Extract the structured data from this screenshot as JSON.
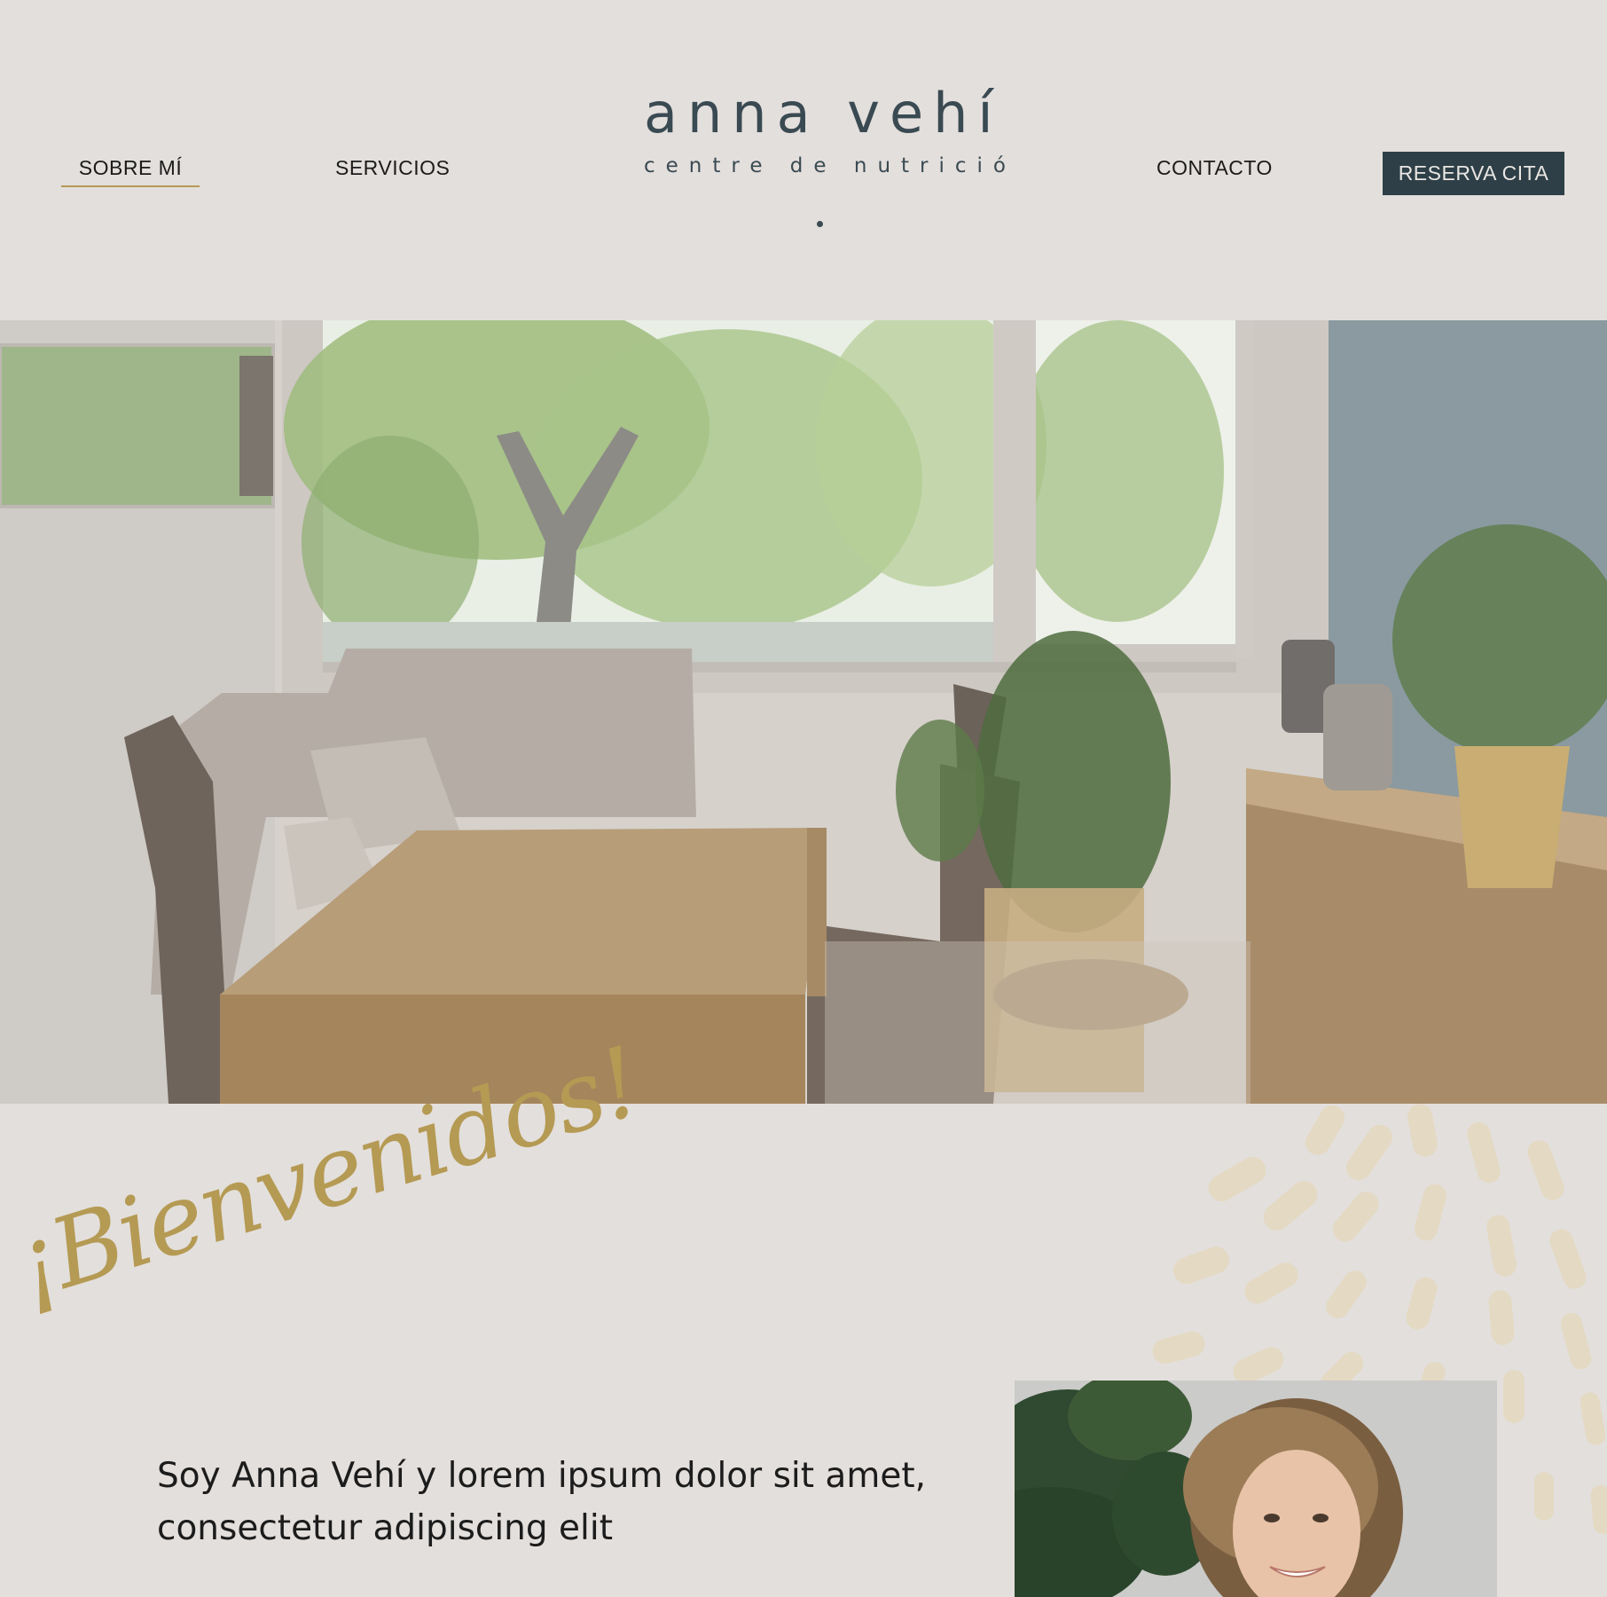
{
  "header": {
    "nav": {
      "about": "SOBRE MÍ",
      "services": "SERVICIOS",
      "contact": "CONTACTO"
    },
    "logo": {
      "name": "anna vehí",
      "subtitle": "centre de nutrició"
    },
    "cta_label": "RESERVA CITA"
  },
  "colors": {
    "background": "#e3dfdc",
    "accent_gold": "#b59a54",
    "dark_slate": "#2e3f47",
    "logo_text": "#3a4a52"
  },
  "hero": {
    "image": "consultation-room-photo"
  },
  "welcome": {
    "script_heading": "¡Bienvenidos!",
    "intro_line1": "Soy Anna Vehí y lorem ipsum dolor sit amet,",
    "intro_line2": "consectetur adipiscing elit",
    "portrait": "portrait-photo"
  }
}
